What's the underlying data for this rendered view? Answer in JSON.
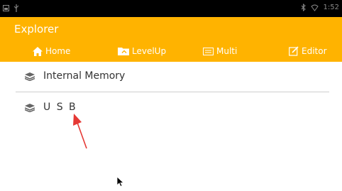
{
  "statusbar": {
    "time": "1:52"
  },
  "app": {
    "title": "Explorer"
  },
  "toolbar": {
    "home": "Home",
    "levelup": "LevelUp",
    "multi": "Multi",
    "editor": "Editor"
  },
  "list": {
    "items": [
      {
        "label": "Internal Memory"
      },
      {
        "label": "U S B"
      }
    ]
  },
  "colors": {
    "accent": "#ffb300",
    "annotation": "#e53935"
  }
}
